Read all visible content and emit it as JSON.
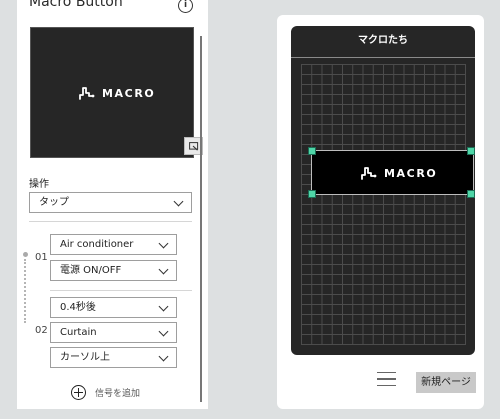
{
  "editor": {
    "title": "Macro Button",
    "button_label": "MACRO",
    "operation_label": "操作",
    "operation_value": "タップ",
    "signals": [
      {
        "number": "01",
        "device": "Air conditioner",
        "command": "電源 ON/OFF"
      },
      {
        "number": "02",
        "delay": "0.4秒後",
        "device": "Curtain",
        "command": "カーソル上"
      }
    ],
    "add_signal_label": "信号を追加"
  },
  "device_preview": {
    "page_title": "マクロたち",
    "button_label": "MACRO",
    "new_page_label": "新規ページ"
  },
  "icons": {
    "info": "info-icon",
    "resize": "resize-icon",
    "chevron": "chevron-down-icon",
    "add": "plus-circle-icon",
    "menu": "hamburger-menu-icon",
    "logo": "macro-logo-icon"
  },
  "colors": {
    "background": "#dde0e1",
    "preview_dark": "#262626",
    "selection_handle": "#4fd6a8",
    "new_page_button": "#c9c9c9"
  }
}
